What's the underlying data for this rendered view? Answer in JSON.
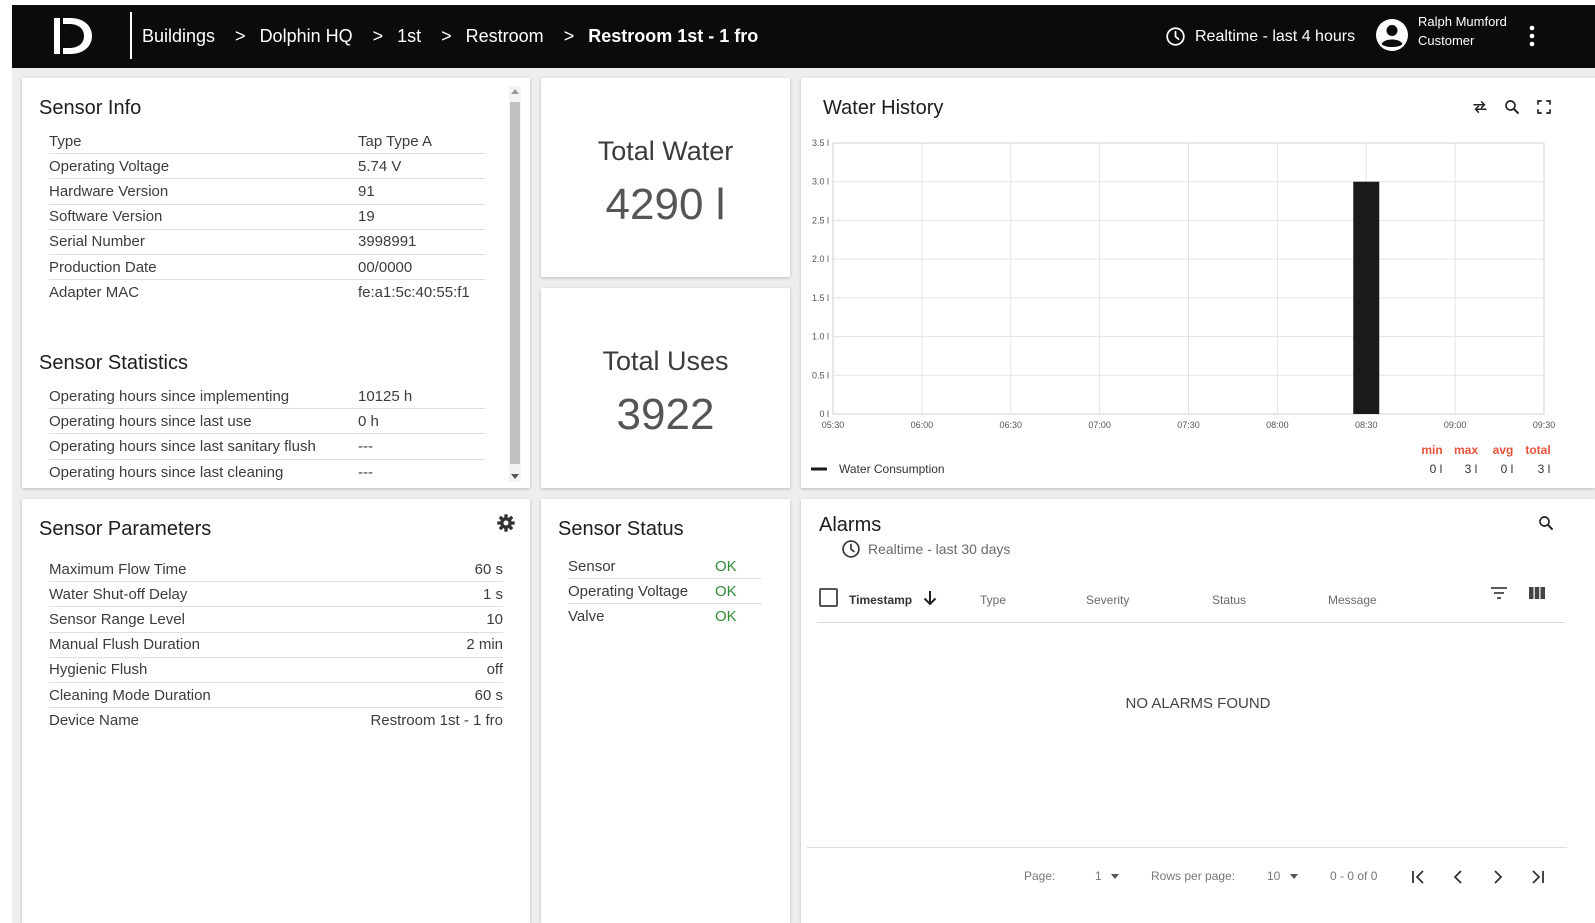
{
  "breadcrumb": [
    {
      "label": "Buildings"
    },
    {
      "label": "Dolphin HQ"
    },
    {
      "label": "1st"
    },
    {
      "label": "Restroom"
    },
    {
      "label": "Restroom 1st - 1 fro"
    }
  ],
  "breadcrumb_sep": ">",
  "header": {
    "time_window": "Realtime - last 4 hours",
    "user_name": "Ralph Mumford",
    "user_role": "Customer"
  },
  "sensor_info": {
    "title": "Sensor Info",
    "rows": [
      {
        "key": "Type",
        "value": "Tap Type A"
      },
      {
        "key": "Operating Voltage",
        "value": "5.74 V"
      },
      {
        "key": "Hardware Version",
        "value": "91"
      },
      {
        "key": "Software Version",
        "value": "19"
      },
      {
        "key": "Serial Number",
        "value": "3998991"
      },
      {
        "key": "Production Date",
        "value": "00/0000"
      },
      {
        "key": "Adapter MAC",
        "value": "fe:a1:5c:40:55:f1"
      }
    ]
  },
  "sensor_statistics": {
    "title": "Sensor Statistics",
    "rows": [
      {
        "key": "Operating hours since implementing",
        "value": "10125 h"
      },
      {
        "key": "Operating hours since last use",
        "value": "0 h"
      },
      {
        "key": "Operating hours since last sanitary flush",
        "value": "---"
      },
      {
        "key": "Operating hours since last cleaning",
        "value": "---"
      }
    ]
  },
  "total_water": {
    "title": "Total Water",
    "value": "4290 l"
  },
  "total_uses": {
    "title": "Total Uses",
    "value": "3922"
  },
  "water_history": {
    "title": "Water History",
    "legend": "Water Consumption",
    "stats": [
      {
        "label": "min",
        "value": "0 l"
      },
      {
        "label": "max",
        "value": "3 l"
      },
      {
        "label": "avg",
        "value": "0 l"
      },
      {
        "label": "total",
        "value": "3 l"
      }
    ]
  },
  "chart_data": {
    "type": "bar",
    "title": "Water History",
    "x_ticks": [
      "05:30",
      "06:00",
      "06:30",
      "07:00",
      "07:30",
      "08:00",
      "08:30",
      "09:00",
      "09:30"
    ],
    "y_ticks": [
      "0 l",
      "0.5 l",
      "1.0 l",
      "1.5 l",
      "2.0 l",
      "2.5 l",
      "3.0 l",
      "3.5 l"
    ],
    "ylim": [
      0,
      3.5
    ],
    "xlim": [
      "05:30",
      "09:30"
    ],
    "series": [
      {
        "name": "Water Consumption",
        "color": "#1a1a1a",
        "points": [
          {
            "x": "08:30",
            "y": 3
          }
        ]
      }
    ],
    "grid": true,
    "legend_position": "bottom-left"
  },
  "sensor_parameters": {
    "title": "Sensor Parameters",
    "rows": [
      {
        "key": "Maximum Flow Time",
        "value": "60 s"
      },
      {
        "key": "Water Shut-off Delay",
        "value": "1 s"
      },
      {
        "key": "Sensor Range Level",
        "value": "10"
      },
      {
        "key": "Manual Flush Duration",
        "value": "2 min"
      },
      {
        "key": "Hygienic Flush",
        "value": "off"
      },
      {
        "key": "Cleaning Mode Duration",
        "value": "60 s"
      },
      {
        "key": "Device Name",
        "value": "Restroom 1st - 1 fro"
      }
    ]
  },
  "sensor_status": {
    "title": "Sensor Status",
    "rows": [
      {
        "key": "Sensor",
        "value": "OK"
      },
      {
        "key": "Operating Voltage",
        "value": "OK"
      },
      {
        "key": "Valve",
        "value": "OK"
      }
    ]
  },
  "alarms": {
    "title": "Alarms",
    "subtitle": "Realtime - last 30 days",
    "columns": [
      "Timestamp",
      "Type",
      "Severity",
      "Status",
      "Message"
    ],
    "empty_text": "NO ALARMS FOUND",
    "footer": {
      "page_label": "Page:",
      "page_value": "1",
      "rows_label": "Rows per page:",
      "rows_value": "10",
      "range": "0 - 0 of 0"
    }
  },
  "colors": {
    "topbar": "#0b0b0b",
    "ok_green": "#2e8b35",
    "stats_label": "#e8543c",
    "bar": "#1a1a1a"
  },
  "icons": {
    "logo": "d-logo-icon",
    "time": "clock-icon",
    "user": "account-circle-icon",
    "more": "more-vert-icon",
    "settings": "gear-icon",
    "swap": "swap-icon",
    "zoom": "zoom-icon",
    "fullscreen": "fullscreen-icon",
    "search": "search-icon",
    "filter": "filter-icon",
    "columns": "columns-icon"
  }
}
